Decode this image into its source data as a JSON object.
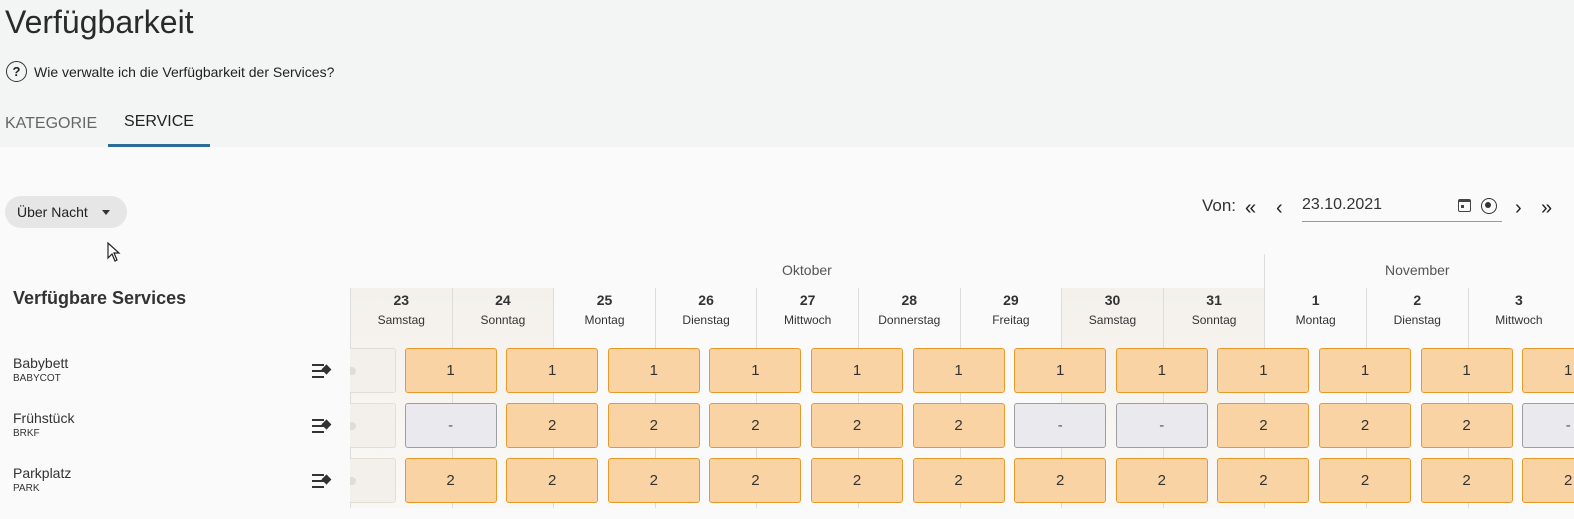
{
  "page": {
    "title": "Verfügbarkeit"
  },
  "help": {
    "icon": "help-circle-icon",
    "text": "Wie verwalte ich die Verfügbarkeit der Services?"
  },
  "tabs": [
    {
      "label": "KATEGORIE"
    },
    {
      "label": "SERVICE"
    }
  ],
  "filter": {
    "selected": "Über Nacht"
  },
  "date_nav": {
    "label": "Von:",
    "value": "23.10.2021",
    "first_icon": "«",
    "prev_icon": "‹",
    "next_icon": "›",
    "last_icon": "»"
  },
  "services_heading": "Verfügbare Services",
  "months": [
    {
      "label": "Oktober"
    },
    {
      "label": "November"
    }
  ],
  "days": [
    {
      "num": "23",
      "name": "Samstag"
    },
    {
      "num": "24",
      "name": "Sonntag"
    },
    {
      "num": "25",
      "name": "Montag"
    },
    {
      "num": "26",
      "name": "Dienstag"
    },
    {
      "num": "27",
      "name": "Mittwoch"
    },
    {
      "num": "28",
      "name": "Donnerstag"
    },
    {
      "num": "29",
      "name": "Freitag"
    },
    {
      "num": "30",
      "name": "Samstag"
    },
    {
      "num": "31",
      "name": "Sonntag"
    },
    {
      "num": "1",
      "name": "Montag"
    },
    {
      "num": "2",
      "name": "Dienstag"
    },
    {
      "num": "3",
      "name": "Mittwoch"
    }
  ],
  "services": [
    {
      "name": "Babybett",
      "code": "BABYCOT",
      "values": [
        "1",
        "1",
        "1",
        "1",
        "1",
        "1",
        "1",
        "1",
        "1",
        "1",
        "1",
        "1"
      ]
    },
    {
      "name": "Frühstück",
      "code": "BRKF",
      "values": [
        "-",
        "-",
        "2",
        "2",
        "2",
        "2",
        "2",
        "-",
        "-",
        "2",
        "2",
        "2"
      ]
    },
    {
      "name": "Parkplatz",
      "code": "PARK",
      "values": [
        "2",
        "2",
        "2",
        "2",
        "2",
        "2",
        "2",
        "2",
        "2",
        "2",
        "2",
        "2"
      ]
    }
  ]
}
